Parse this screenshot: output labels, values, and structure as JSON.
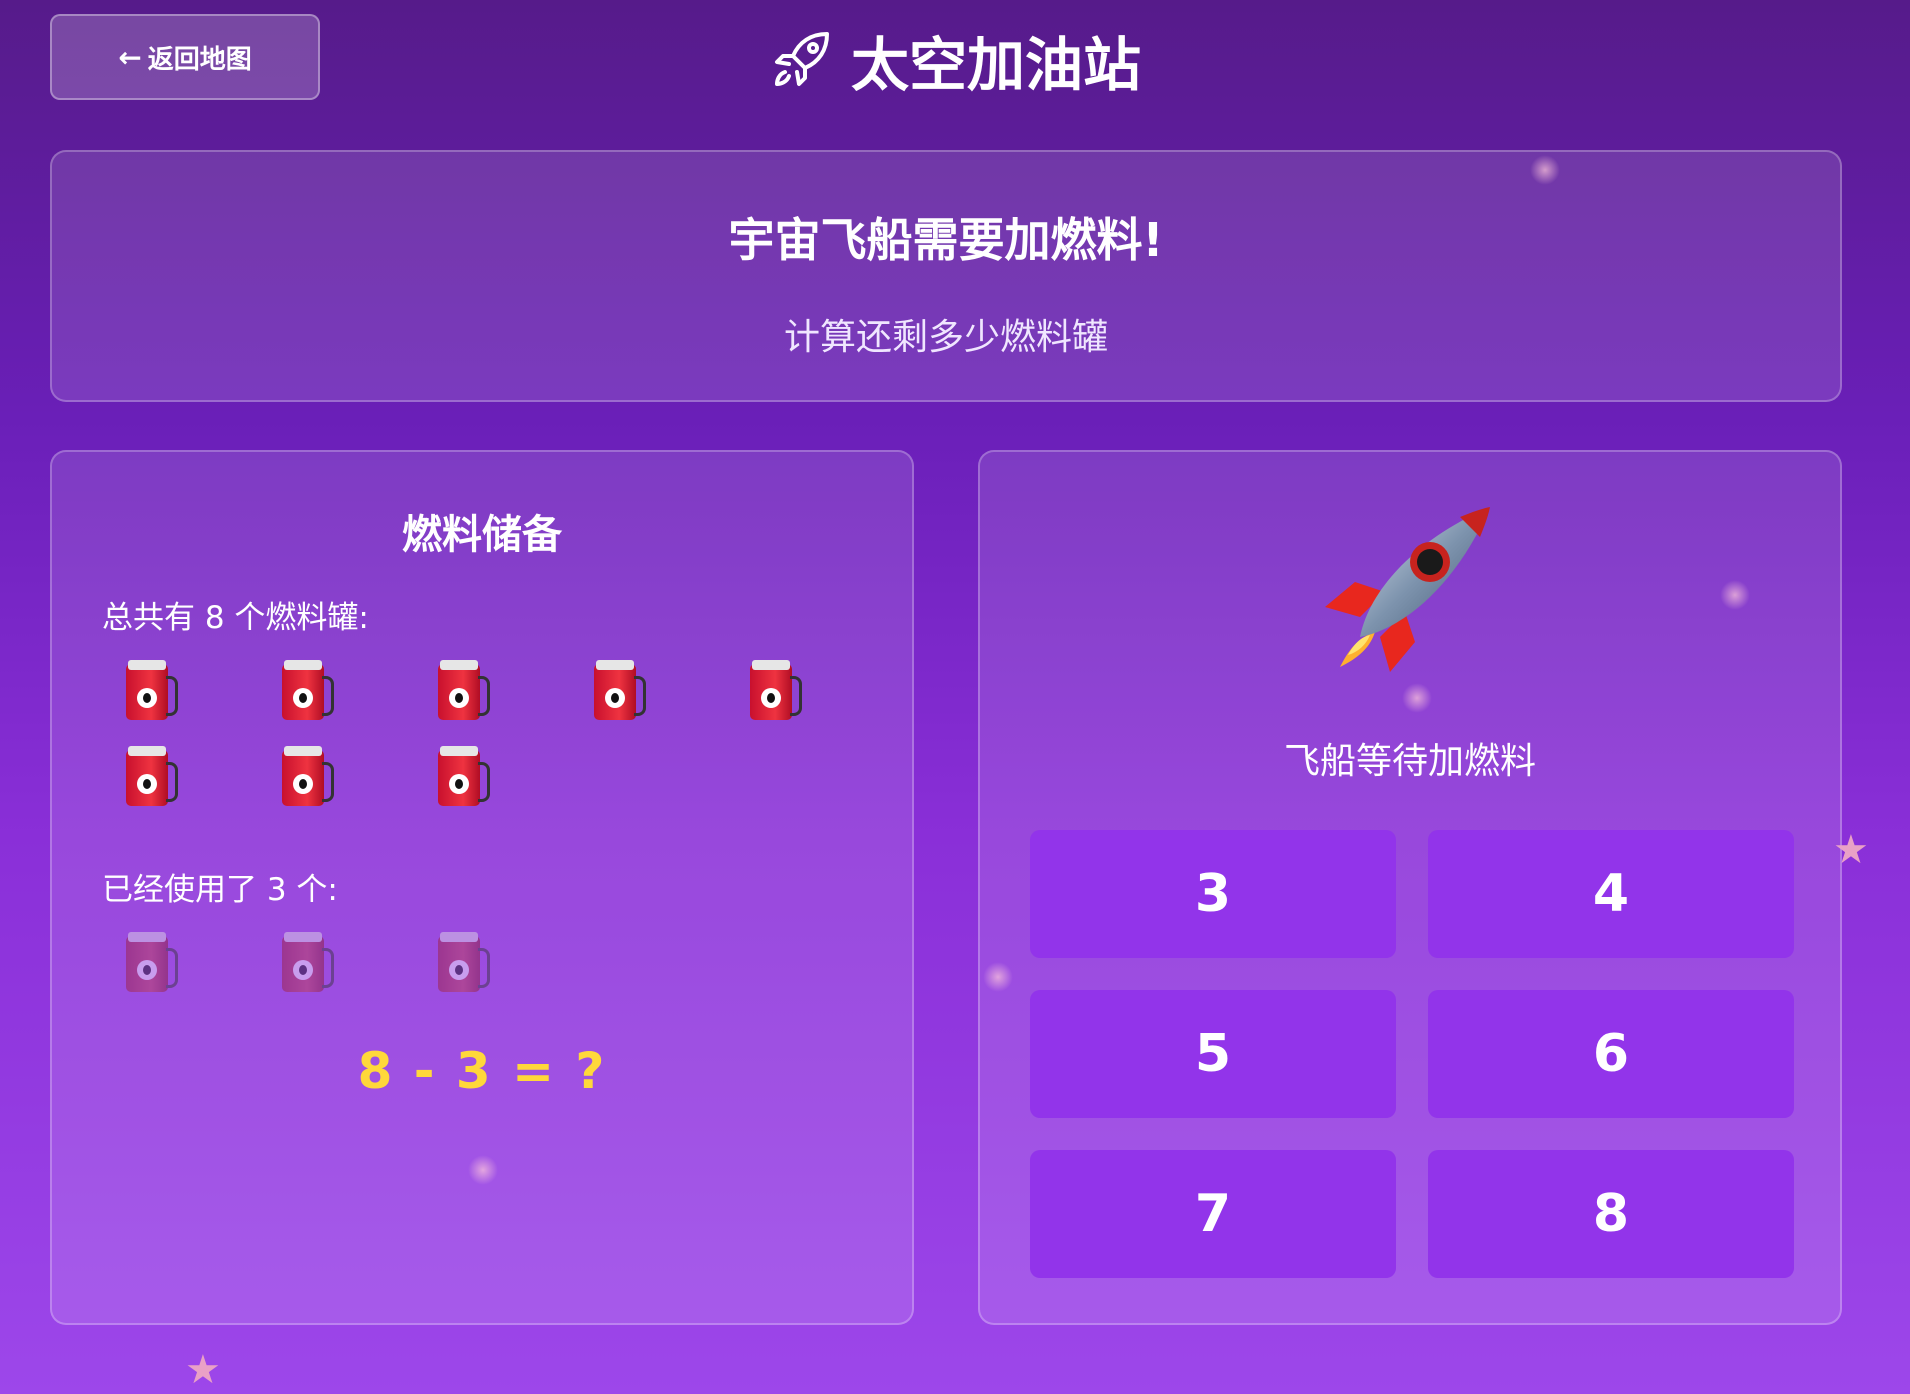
{
  "header": {
    "back_label": "返回地图",
    "back_arrow_icon": "arrow-left-icon",
    "title": "太空加油站",
    "title_icon": "rocket-outline-icon"
  },
  "intro": {
    "heading": "宇宙飞船需要加燃料!",
    "subtitle": "计算还剩多少燃料罐"
  },
  "fuel_panel": {
    "title": "燃料储备",
    "total_label": "总共有 8 个燃料罐:",
    "total_count": 8,
    "used_label": "已经使用了 3 个:",
    "used_count": 3,
    "tank_icon": "fuel-pump-icon",
    "equation": "8 - 3 = ?"
  },
  "ship_panel": {
    "rocket_icon": "rocket-icon",
    "status": "飞船等待加燃料",
    "answers": [
      "3",
      "4",
      "5",
      "6",
      "7",
      "8"
    ]
  },
  "colors": {
    "equation": "#ffd83a",
    "answer_button": "#9234ea"
  }
}
